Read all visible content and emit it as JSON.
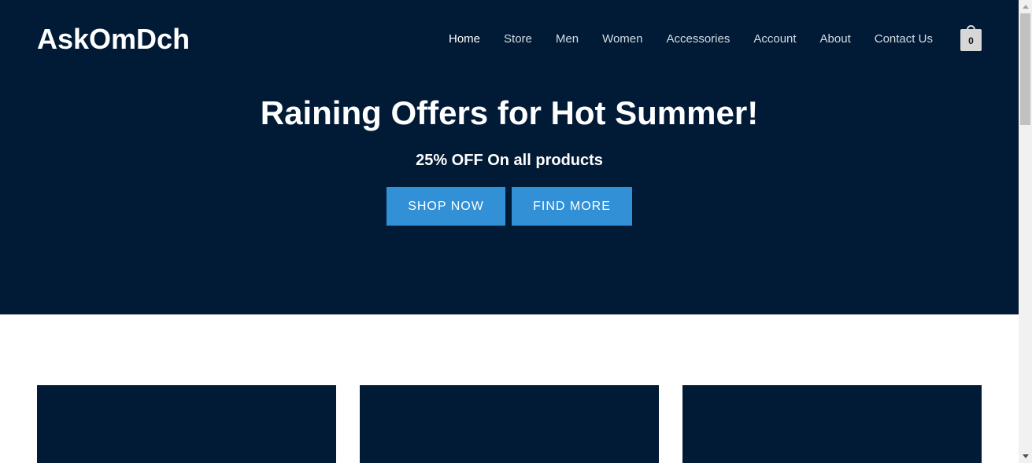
{
  "site": {
    "logo": "AskOmDch"
  },
  "nav": {
    "items": [
      {
        "label": "Home",
        "active": true
      },
      {
        "label": "Store",
        "active": false
      },
      {
        "label": "Men",
        "active": false
      },
      {
        "label": "Women",
        "active": false
      },
      {
        "label": "Accessories",
        "active": false
      },
      {
        "label": "Account",
        "active": false
      },
      {
        "label": "About",
        "active": false
      },
      {
        "label": "Contact Us",
        "active": false
      }
    ],
    "cart_count": "0"
  },
  "hero": {
    "title": "Raining Offers for Hot Summer!",
    "subtitle": "25% OFF On all products",
    "primary_button": "SHOP NOW",
    "secondary_button": "FIND MORE"
  },
  "colors": {
    "hero_background": "#011b36",
    "button_background": "#3190d6",
    "card_background": "#011b36",
    "cart_badge": "#d7d7d7"
  },
  "icons": {
    "cart": "shopping-bag-icon"
  }
}
